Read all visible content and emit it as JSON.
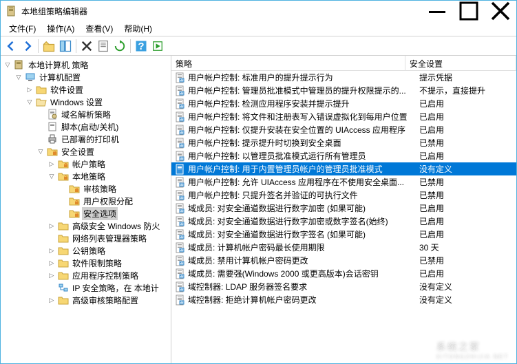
{
  "window": {
    "title": "本地组策略编辑器"
  },
  "menus": {
    "file": "文件(F)",
    "action": "操作(A)",
    "view": "查看(V)",
    "help": "帮助(H)"
  },
  "tree": {
    "root": "本地计算机 策略",
    "computer_config": "计算机配置",
    "software_settings": "软件设置",
    "windows_settings": "Windows 设置",
    "dns_policy": "域名解析策略",
    "scripts": "脚本(启动/关机)",
    "deployed_printers": "已部署的打印机",
    "security_settings": "安全设置",
    "account_policies": "帐户策略",
    "local_policies": "本地策略",
    "audit_policy": "审核策略",
    "user_rights": "用户权限分配",
    "security_options": "安全选项",
    "firewall": "高级安全 Windows 防火",
    "nlm": "网络列表管理器策略",
    "pubkey": "公钥策略",
    "srp": "软件限制策略",
    "applocker": "应用程序控制策略",
    "ipsec": "IP 安全策略，在 本地计",
    "adv_audit": "高级审核策略配置"
  },
  "columns": {
    "policy": "策略",
    "security_setting": "安全设置"
  },
  "rows": [
    {
      "policy": "用户帐户控制: 标准用户的提升提示行为",
      "setting": "提示凭据"
    },
    {
      "policy": "用户帐户控制: 管理员批准模式中管理员的提升权限提示的...",
      "setting": "不提示，直接提升"
    },
    {
      "policy": "用户帐户控制: 检测应用程序安装并提示提升",
      "setting": "已启用"
    },
    {
      "policy": "用户帐户控制: 将文件和注册表写入错误虚拟化到每用户位置",
      "setting": "已启用"
    },
    {
      "policy": "用户帐户控制: 仅提升安装在安全位置的 UIAccess 应用程序",
      "setting": "已启用"
    },
    {
      "policy": "用户帐户控制: 提示提升时切换到安全桌面",
      "setting": "已禁用"
    },
    {
      "policy": "用户帐户控制: 以管理员批准模式运行所有管理员",
      "setting": "已启用"
    },
    {
      "policy": "用户帐户控制: 用于内置管理员帐户的管理员批准模式",
      "setting": "没有定义",
      "selected": true
    },
    {
      "policy": "用户帐户控制: 允许 UIAccess 应用程序在不使用安全桌面...",
      "setting": "已禁用"
    },
    {
      "policy": "用户帐户控制: 只提升签名并验证的可执行文件",
      "setting": "已禁用"
    },
    {
      "policy": "域成员: 对安全通道数据进行数字加密 (如果可能)",
      "setting": "已启用"
    },
    {
      "policy": "域成员: 对安全通道数据进行数字加密或数字签名(始终)",
      "setting": "已启用"
    },
    {
      "policy": "域成员: 对安全通道数据进行数字签名 (如果可能)",
      "setting": "已启用"
    },
    {
      "policy": "域成员: 计算机帐户密码最长使用期限",
      "setting": "30 天"
    },
    {
      "policy": "域成员: 禁用计算机帐户密码更改",
      "setting": "已禁用"
    },
    {
      "policy": "域成员: 需要强(Windows 2000 或更高版本)会话密钥",
      "setting": "已启用"
    },
    {
      "policy": "域控制器: LDAP 服务器签名要求",
      "setting": "没有定义"
    },
    {
      "policy": "域控制器: 拒绝计算机帐户密码更改",
      "setting": "没有定义"
    }
  ],
  "watermark": "系统之家",
  "watermark_url": "XITONGZHIJIA.NET"
}
